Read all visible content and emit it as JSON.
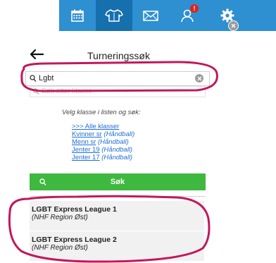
{
  "nav": {
    "tabs": [
      {
        "icon": "calendar-icon",
        "active": false
      },
      {
        "icon": "jersey-icon",
        "active": true
      },
      {
        "icon": "mail-icon",
        "active": false
      },
      {
        "icon": "person-icon",
        "active": false,
        "badge": "!"
      },
      {
        "icon": "gear-icon",
        "active": false
      }
    ]
  },
  "header": {
    "title": "Turneringssøk"
  },
  "search": {
    "value": "Lgbt",
    "secondary_placeholder": "Søk etter klasse"
  },
  "classes": {
    "hint": "Velg klasse i listen og søk:",
    "items": [
      {
        "link": ">>> Alle klasser",
        "sport": ""
      },
      {
        "link": "Kvinner sr",
        "sport": "(Håndball)"
      },
      {
        "link": "Menn sr",
        "sport": "(Håndball)"
      },
      {
        "link": "Jenter 19",
        "sport": "(Håndball)"
      },
      {
        "link": "Jenter 17",
        "sport": "(Håndball)"
      }
    ]
  },
  "search_button": {
    "label": "Søk"
  },
  "results": [
    {
      "name": "LGBT Express League 1",
      "region": "(NHF Region Øst)"
    },
    {
      "name": "LGBT Express League 2",
      "region": "(NHF Region Øst)"
    }
  ],
  "colors": {
    "nav_bg": "#2e8fd1",
    "nav_active": "#1670ad",
    "button": "#3fb83f",
    "link": "#1e6fd6",
    "annotation": "#c2185b"
  }
}
